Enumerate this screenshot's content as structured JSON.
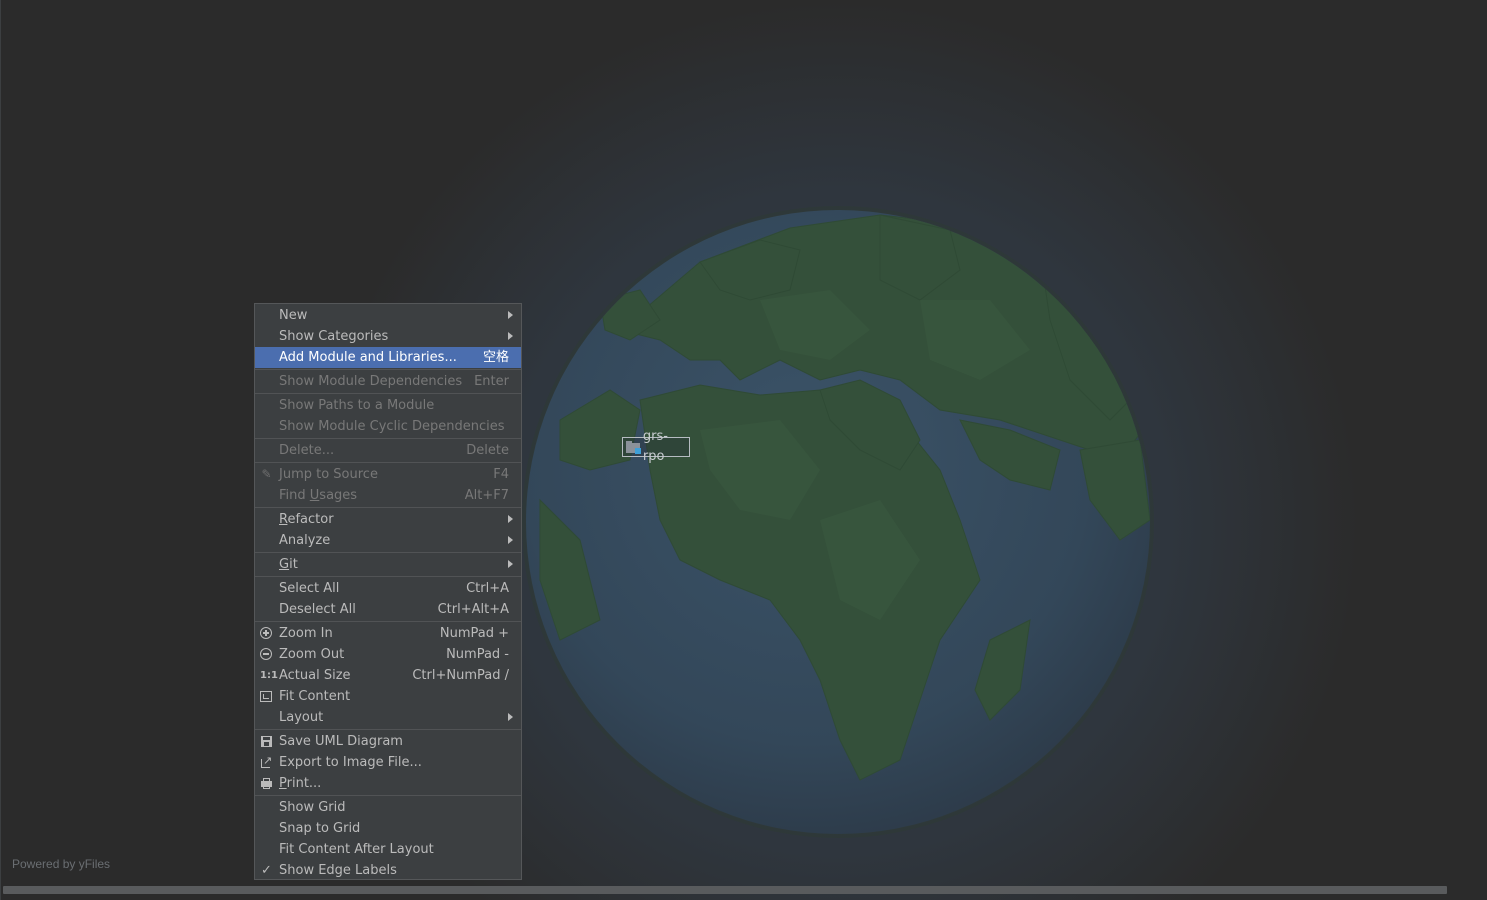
{
  "canvas": {
    "node_label": "grs-rpo",
    "powered_by": "Powered by yFiles"
  },
  "colors": {
    "background": "#2b2b2b",
    "menu_bg": "#3c3f41",
    "selection": "#4b6eaf",
    "globe_ocean": "#354a5c",
    "globe_land": "#35533a"
  },
  "menu": {
    "new": {
      "label": "New",
      "submenu": true
    },
    "show_categories": {
      "label": "Show Categories",
      "submenu": true
    },
    "add_module": {
      "label": "Add Module and Libraries...",
      "shortcut": "空格",
      "selected": true
    },
    "show_module_deps": {
      "label": "Show Module Dependencies",
      "shortcut": "Enter",
      "disabled": true
    },
    "show_paths": {
      "label": "Show Paths to a Module",
      "disabled": true
    },
    "show_cyclic": {
      "label": "Show Module Cyclic Dependencies",
      "disabled": true
    },
    "delete": {
      "label": "Delete...",
      "shortcut": "Delete",
      "disabled": true
    },
    "jump_to_source": {
      "label": "Jump to Source",
      "shortcut": "F4",
      "disabled": true,
      "icon": "pencil-icon"
    },
    "find_usages": {
      "label_pre": "Find ",
      "label_u": "U",
      "label_post": "sages",
      "shortcut": "Alt+F7",
      "disabled": true
    },
    "refactor": {
      "label_u": "R",
      "label_post": "efactor",
      "submenu": true
    },
    "analyze": {
      "label": "Analyze",
      "submenu": true
    },
    "git": {
      "label_u": "G",
      "label_post": "it",
      "submenu": true
    },
    "select_all": {
      "label": "Select All",
      "shortcut": "Ctrl+A"
    },
    "deselect_all": {
      "label": "Deselect All",
      "shortcut": "Ctrl+Alt+A"
    },
    "zoom_in": {
      "label": "Zoom In",
      "shortcut": "NumPad +",
      "icon": "zoom-in-icon"
    },
    "zoom_out": {
      "label": "Zoom Out",
      "shortcut": "NumPad -",
      "icon": "zoom-out-icon"
    },
    "actual_size": {
      "label": "Actual Size",
      "shortcut": "Ctrl+NumPad /",
      "icon": "actual-size-icon",
      "icon_text": "1:1"
    },
    "fit_content": {
      "label": "Fit Content",
      "icon": "fit-content-icon"
    },
    "layout": {
      "label": "Layout",
      "submenu": true
    },
    "save_uml": {
      "label": "Save UML Diagram",
      "icon": "save-icon"
    },
    "export_image": {
      "label": "Export to Image File...",
      "icon": "export-icon"
    },
    "print": {
      "label_u": "P",
      "label_post": "rint...",
      "icon": "print-icon"
    },
    "show_grid": {
      "label": "Show Grid"
    },
    "snap_to_grid": {
      "label": "Snap to Grid"
    },
    "fit_after_layout": {
      "label": "Fit Content After Layout"
    },
    "show_edge_labels": {
      "label": "Show Edge Labels",
      "checked": true,
      "icon": "check-icon",
      "icon_text": "✓"
    }
  }
}
